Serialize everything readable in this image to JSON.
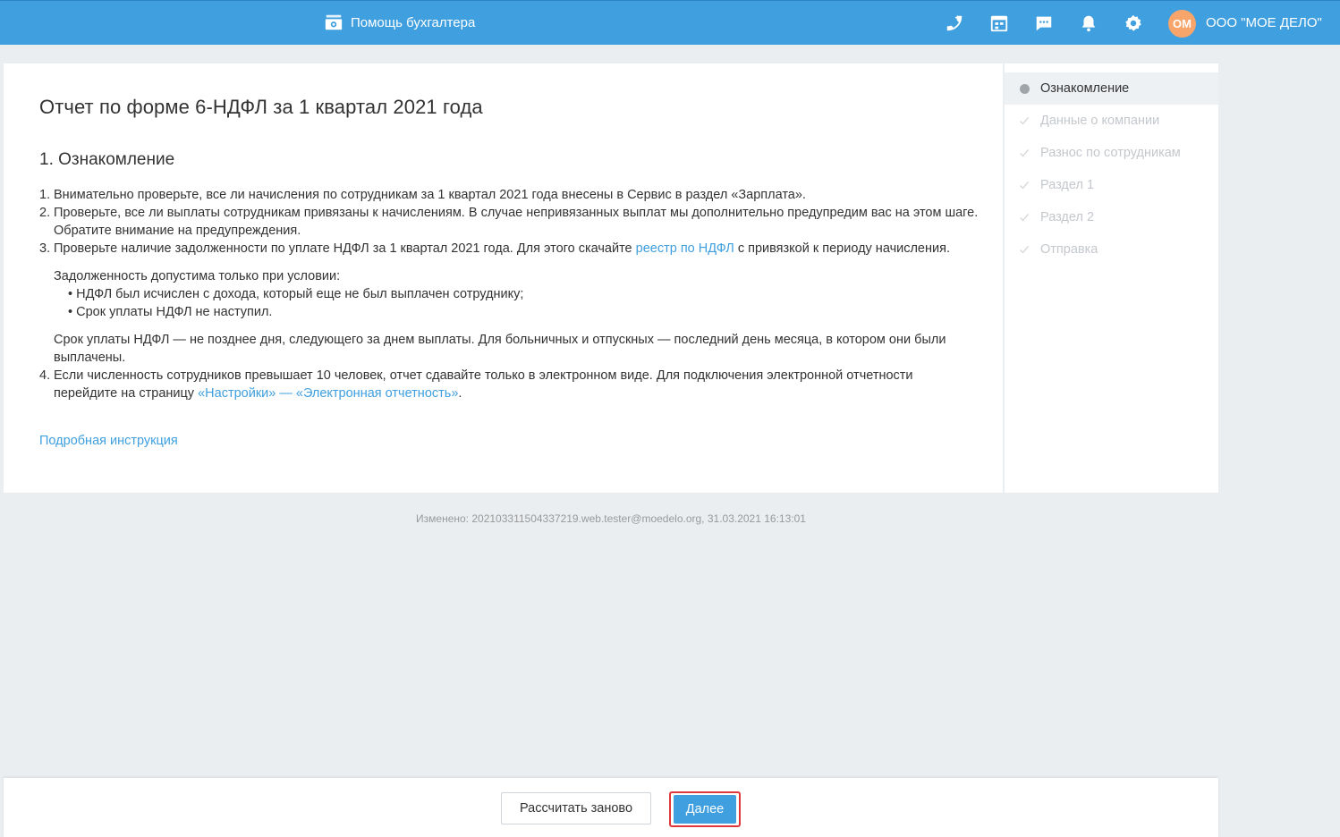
{
  "header": {
    "assistant_label": "Помощь бухгалтера",
    "company_name": "ООО \"МОЕ ДЕЛО\"",
    "avatar_initials": "ОМ",
    "icons": [
      "phone-icon",
      "calendar-icon",
      "chat-icon",
      "bell-icon",
      "gear-icon"
    ]
  },
  "main": {
    "title": "Отчет по форме 6-НДФЛ за 1 квартал 2021 года",
    "section_title": "1. Ознакомление",
    "items": [
      {
        "num": "1.",
        "text": "Внимательно проверьте, все ли начисления по сотрудникам за 1 квартал 2021 года внесены в Сервис в раздел «Зарплата»."
      },
      {
        "num": "2.",
        "text": "Проверьте, все ли выплаты сотрудникам привязаны к начислениям. В случае непривязанных выплат мы дополнительно предупредим вас на этом шаге. Обратите внимание на предупреждения."
      },
      {
        "num": "3.",
        "text_before": "Проверьте наличие задолженности по уплате НДФЛ за 1 квартал 2021 года. Для этого скачайте ",
        "link": "реестр по НДФЛ",
        "text_after": " с привязкой к периоду начисления."
      },
      {
        "num": "4.",
        "text_before": "Если численность сотрудников превышает 10 человек, отчет сдавайте только в электронном виде. Для подключения электронной отчетности перейдите на страницу ",
        "link": "«Настройки» — «Электронная отчетность»",
        "text_after": "."
      }
    ],
    "debt_condition": "Задолженность допустима только при условии:",
    "bullets": [
      "НДФЛ был исчислен с дохода, который еще не был выплачен сотруднику;",
      "Срок уплаты НДФЛ не наступил."
    ],
    "deadline_note": "Срок уплаты НДФЛ — не позднее дня, следующего за днем выплаты. Для больничных и отпускных — последний день месяца, в котором они были выплачены.",
    "instruction_link": "Подробная инструкция"
  },
  "steps": [
    {
      "label": "Ознакомление",
      "active": true
    },
    {
      "label": "Данные о компании",
      "active": false
    },
    {
      "label": "Разнос по сотрудникам",
      "active": false
    },
    {
      "label": "Раздел 1",
      "active": false
    },
    {
      "label": "Раздел 2",
      "active": false
    },
    {
      "label": "Отправка",
      "active": false
    }
  ],
  "footer": {
    "modified": "Изменено: 202103311504337219.web.tester@moedelo.org, 31.03.2021 16:13:01"
  },
  "actions": {
    "recalc_label": "Рассчитать заново",
    "next_label": "Далее"
  },
  "colors": {
    "brand": "#3f9fdf",
    "avatar": "#f7a56b",
    "highlight": "#e0373a"
  }
}
